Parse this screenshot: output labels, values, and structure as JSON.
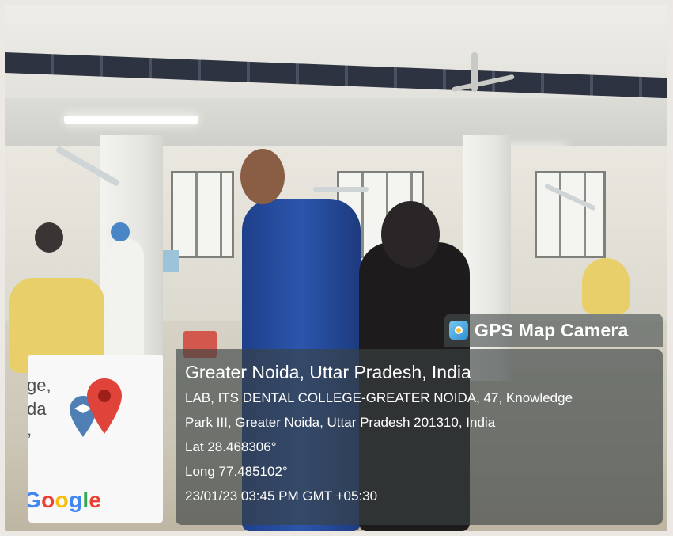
{
  "overlay": {
    "badge_label": "GPS Map Camera",
    "city": "Greater Noida, Uttar Pradesh, India",
    "address_line_1": "LAB, ITS DENTAL COLLEGE-GREATER NOIDA, 47, Knowledge",
    "address_line_2": "Park III, Greater Noida, Uttar Pradesh 201310, India",
    "latitude": "Lat 28.468306°",
    "longitude": "Long 77.485102°",
    "datetime": "23/01/23 03:45 PM GMT +05:30"
  },
  "map_thumbnail": {
    "fragment_1": "ge,",
    "fragment_2": "da",
    "fragment_3": ",",
    "logo_letters": [
      "G",
      "o",
      "o",
      "g",
      "l",
      "e"
    ],
    "logo_colors": [
      "#4285F4",
      "#EA4335",
      "#FBBC05",
      "#4285F4",
      "#34A853",
      "#EA4335"
    ],
    "pin_icon": "location-pin-icon",
    "pin_color": "#E0433A",
    "secondary_pin_icon": "graduation-cap-pin-icon",
    "secondary_pin_color": "#4F7FB5"
  },
  "badge": {
    "icon": "camera-app-icon",
    "accent": "#2F8FD2"
  }
}
